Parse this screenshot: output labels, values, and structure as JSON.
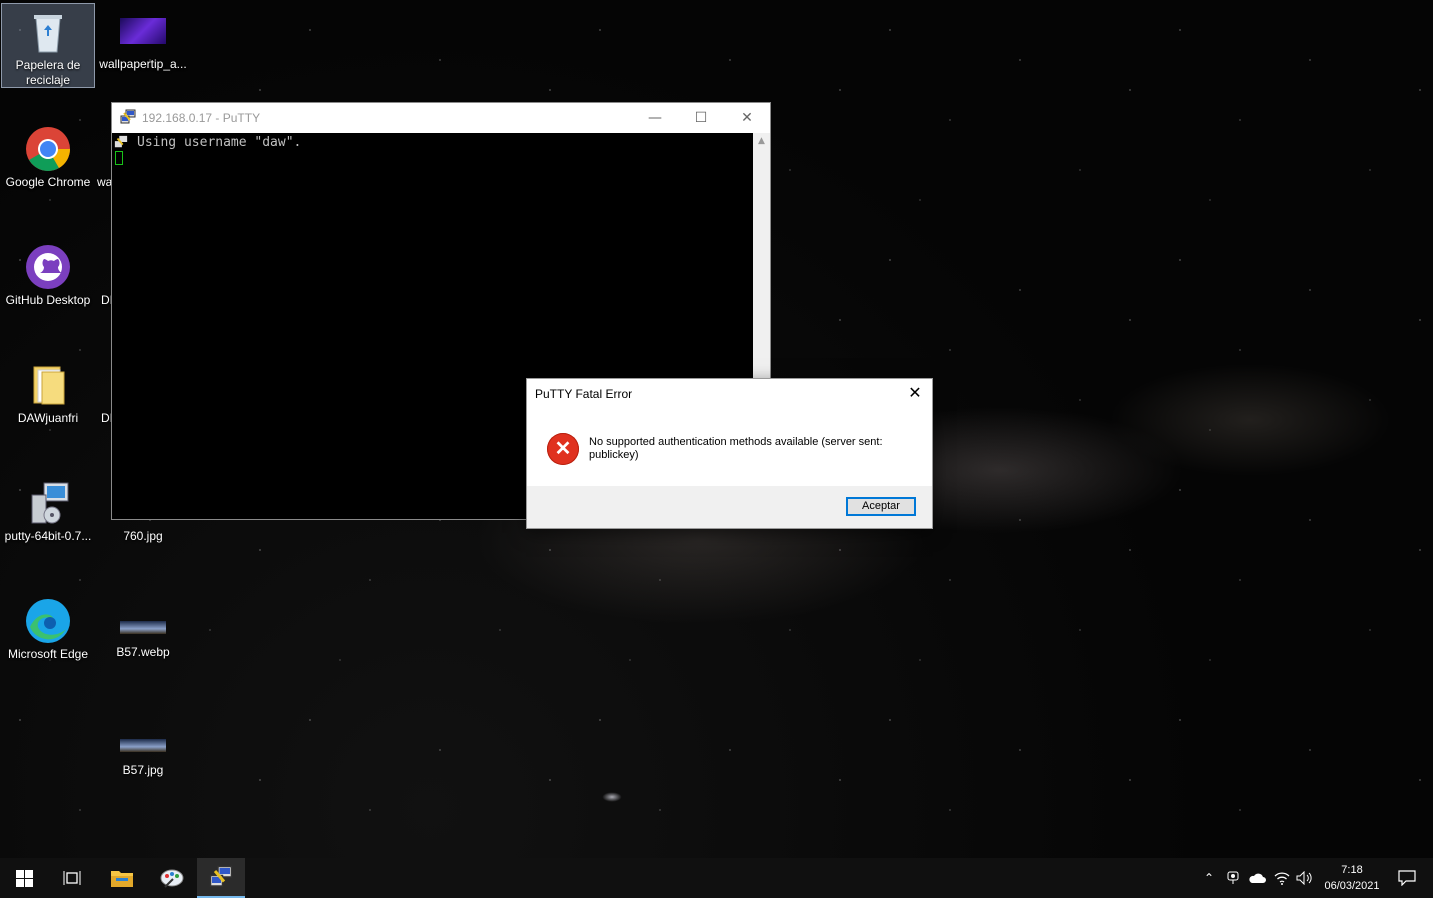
{
  "desktop": {
    "icons": [
      {
        "label": "Papelera de reciclaje"
      },
      {
        "label": "wallpapertip_a..."
      },
      {
        "label": "Google Chrome"
      },
      {
        "label": "wa"
      },
      {
        "label": "GitHub Desktop"
      },
      {
        "label": "DI"
      },
      {
        "label": "DAWjuanfri"
      },
      {
        "label": "DI"
      },
      {
        "label": "putty-64bit-0.7..."
      },
      {
        "label": "760.jpg"
      },
      {
        "label": "Microsoft Edge"
      },
      {
        "label": "B57.webp"
      },
      {
        "label": "B57.jpg"
      }
    ]
  },
  "putty": {
    "title": "192.168.0.17 - PuTTY",
    "terminal_line": "Using username \"daw\"."
  },
  "dialog": {
    "title": "PuTTY Fatal Error",
    "message": "No supported authentication methods available (server sent: publickey)",
    "ok_label": "Aceptar"
  },
  "taskbar": {
    "time": "7:18",
    "date": "06/03/2021"
  },
  "colors": {
    "accent": "#0078d7",
    "error": "#e0311f",
    "cursor": "#19c219"
  }
}
